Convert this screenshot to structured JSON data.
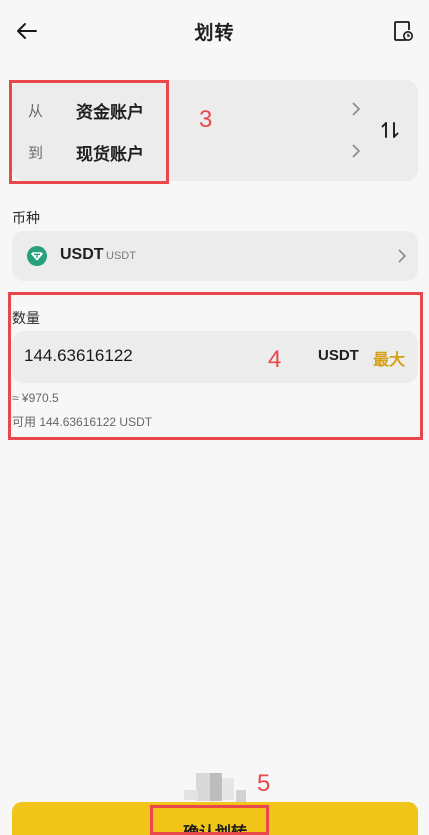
{
  "header": {
    "title": "划转"
  },
  "transfer": {
    "from_prefix": "从",
    "from_account": "资金账户",
    "to_prefix": "到",
    "to_account": "现货账户"
  },
  "coin": {
    "label": "币种",
    "name": "USDT",
    "sub": "USDT"
  },
  "amount": {
    "label": "数量",
    "value": "144.63616122",
    "unit": "USDT",
    "max_label": "最大",
    "approx": "≈ ¥970.5",
    "available": "可用 144.63616122 USDT"
  },
  "confirm": {
    "label": "确认划转"
  },
  "annotations": {
    "a3": "3",
    "a4": "4",
    "a5": "5"
  },
  "colors": {
    "accent": "#f0c419",
    "max_text": "#d4a017",
    "annotation": "#e9484b",
    "usdt": "#26a17b"
  },
  "icons": [
    "back-arrow-icon",
    "history-icon",
    "chevron-right-icon",
    "swap-icon",
    "usdt-logo-icon"
  ]
}
